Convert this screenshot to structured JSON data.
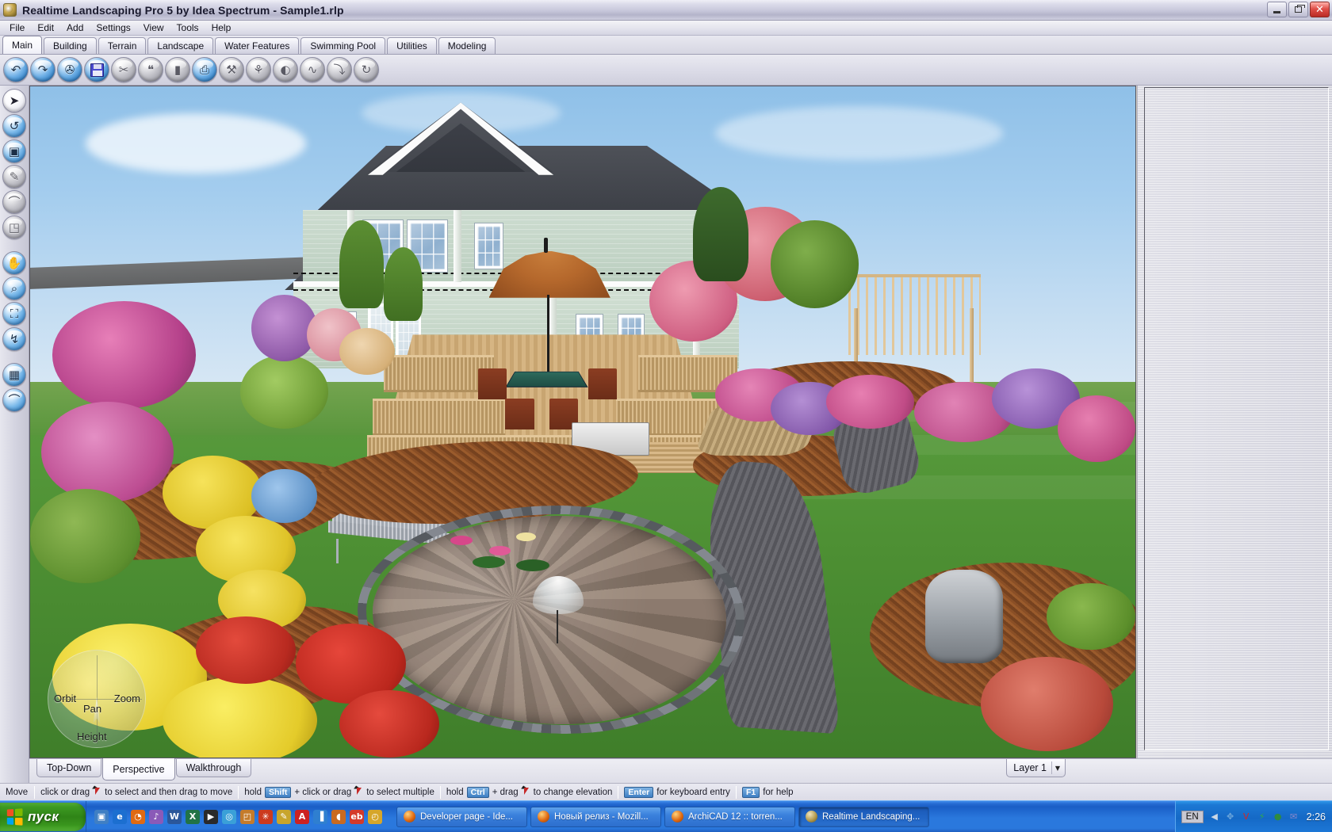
{
  "window": {
    "title": "Realtime Landscaping Pro 5 by Idea Spectrum - Sample1.rlp",
    "app_icon": "app-logo-icon",
    "minimize_label": "Minimize",
    "restore_label": "Restore",
    "close_label": "Close"
  },
  "menu": {
    "items": [
      {
        "label": "File"
      },
      {
        "label": "Edit"
      },
      {
        "label": "Add"
      },
      {
        "label": "Settings"
      },
      {
        "label": "View"
      },
      {
        "label": "Tools"
      },
      {
        "label": "Help"
      }
    ]
  },
  "ribbon_tabs": {
    "active": "Main",
    "items": [
      {
        "label": "Main"
      },
      {
        "label": "Building"
      },
      {
        "label": "Terrain"
      },
      {
        "label": "Landscape"
      },
      {
        "label": "Water Features"
      },
      {
        "label": "Swimming Pool"
      },
      {
        "label": "Utilities"
      },
      {
        "label": "Modeling"
      }
    ]
  },
  "toolbar_top": {
    "buttons": [
      {
        "name": "undo-icon",
        "glyph": "↶",
        "state": "enabled"
      },
      {
        "name": "redo-icon",
        "glyph": "↷",
        "state": "enabled"
      },
      {
        "name": "open-folder-icon",
        "glyph": "✇",
        "state": "enabled"
      },
      {
        "name": "save-disk-icon",
        "glyph": "",
        "state": "enabled"
      },
      {
        "name": "cut-icon",
        "glyph": "✂",
        "state": "disabled"
      },
      {
        "name": "copy-icon",
        "glyph": "❝",
        "state": "disabled"
      },
      {
        "name": "paste-icon",
        "glyph": "▮",
        "state": "disabled"
      },
      {
        "name": "print-icon",
        "glyph": "⎙",
        "state": "enabled"
      },
      {
        "name": "terrain-icon",
        "glyph": "⚒",
        "state": "disabled"
      },
      {
        "name": "flatten-icon",
        "glyph": "⚘",
        "state": "disabled"
      },
      {
        "name": "mirror-icon",
        "glyph": "◐",
        "state": "disabled"
      },
      {
        "name": "smooth-icon",
        "glyph": "∿",
        "state": "disabled"
      },
      {
        "name": "curve-icon",
        "glyph": "⤵",
        "state": "disabled"
      },
      {
        "name": "rotate-icon",
        "glyph": "↻",
        "state": "disabled"
      }
    ]
  },
  "toolbar_left": {
    "buttons": [
      {
        "name": "select-arrow-icon",
        "glyph": "➤",
        "state": "selected"
      },
      {
        "name": "orbit-icon",
        "glyph": "↺",
        "state": "enabled"
      },
      {
        "name": "zoom-region-icon",
        "glyph": "▣",
        "state": "enabled"
      },
      {
        "name": "draw-region-icon",
        "glyph": "✎",
        "state": "disabled"
      },
      {
        "name": "draw-curve-icon",
        "glyph": "⌒",
        "state": "disabled"
      },
      {
        "name": "draw-polyline-icon",
        "glyph": "◳",
        "state": "disabled"
      },
      {
        "name": "pan-hand-icon",
        "glyph": "✋",
        "state": "enabled"
      },
      {
        "name": "zoom-magnifier-icon",
        "glyph": "⌕",
        "state": "enabled"
      },
      {
        "name": "zoom-extents-icon",
        "glyph": "⛶",
        "state": "enabled"
      },
      {
        "name": "walkthrough-icon",
        "glyph": "↯",
        "state": "enabled"
      },
      {
        "name": "terrain-grid-icon",
        "glyph": "▦",
        "state": "enabled"
      },
      {
        "name": "magnet-snap-icon",
        "glyph": "⌒",
        "state": "enabled"
      }
    ]
  },
  "viewport": {
    "navigator": {
      "orbit_label": "Orbit",
      "zoom_label": "Zoom",
      "pan_label": "Pan",
      "height_label": "Height"
    }
  },
  "view_tabs": {
    "active": "Perspective",
    "items": [
      {
        "label": "Top-Down"
      },
      {
        "label": "Perspective"
      },
      {
        "label": "Walkthrough"
      }
    ]
  },
  "layer_select": {
    "value": "Layer 1",
    "arrow": "▼"
  },
  "statusbar": {
    "mode": "Move",
    "hints": [
      {
        "pre": "click or drag",
        "cursor": true,
        "key": "",
        "mid": "",
        "post": "to select and then drag to move"
      },
      {
        "pre": "hold",
        "cursor": false,
        "key": "Shift",
        "mid": "+ click or drag",
        "post": "to select multiple",
        "cursor_after": true
      },
      {
        "pre": "hold",
        "cursor": false,
        "key": "Ctrl",
        "mid": "+ drag",
        "post": "to change elevation",
        "cursor_after": true
      },
      {
        "pre": "",
        "cursor": false,
        "key": "Enter",
        "mid": "",
        "post": "for keyboard entry"
      },
      {
        "pre": "",
        "cursor": false,
        "key": "F1",
        "mid": "",
        "post": "for help"
      }
    ]
  },
  "taskbar": {
    "start_label": "пуск",
    "quick_launch": [
      {
        "name": "show-desktop-icon",
        "glyph": "▣",
        "color": "#3f7fc4"
      },
      {
        "name": "internet-explorer-icon",
        "glyph": "e",
        "color": "#1c6fd0"
      },
      {
        "name": "firefox-icon",
        "glyph": "◔",
        "color": "#e06a12"
      },
      {
        "name": "media-player-icon",
        "glyph": "♪",
        "color": "#8a5ab8"
      },
      {
        "name": "word-icon",
        "glyph": "W",
        "color": "#2b579a"
      },
      {
        "name": "excel-icon",
        "glyph": "X",
        "color": "#217346"
      },
      {
        "name": "video-player-icon",
        "glyph": "▶",
        "color": "#2a2a2a"
      },
      {
        "name": "dvd-tool-icon",
        "glyph": "◎",
        "color": "#3aa0d8"
      },
      {
        "name": "photo-viewer-icon",
        "glyph": "◰",
        "color": "#c47b2a"
      },
      {
        "name": "winamp-icon",
        "glyph": "✳",
        "color": "#cc3a1e"
      },
      {
        "name": "notes-icon",
        "glyph": "✎",
        "color": "#c8a52c"
      },
      {
        "name": "acrobat-icon",
        "glyph": "A",
        "color": "#cc2222"
      },
      {
        "name": "battery-tool-icon",
        "glyph": "▐",
        "color": "#2f7fd0"
      },
      {
        "name": "paint-icon",
        "glyph": "◖",
        "color": "#c96a20"
      },
      {
        "name": "ebay-icon",
        "glyph": "eb",
        "color": "#d43a2a"
      },
      {
        "name": "clock-tool-icon",
        "glyph": "◴",
        "color": "#d6a62a"
      }
    ],
    "tasks": [
      {
        "label": "Developer page - Ide...",
        "icon": "firefox-icon",
        "active": false
      },
      {
        "label": "Новый релиз - Mozill...",
        "icon": "firefox-icon",
        "active": false
      },
      {
        "label": "ArchiCAD 12 :: torren...",
        "icon": "firefox-icon",
        "active": false
      },
      {
        "label": "Realtime Landscaping...",
        "icon": "app-logo-icon",
        "active": true
      }
    ],
    "tray": {
      "language": "EN",
      "icons": [
        {
          "name": "hide-tray-icon",
          "glyph": "◀",
          "color": "#c9d7e6"
        },
        {
          "name": "network-icon",
          "glyph": "✥",
          "color": "#6fa8dc"
        },
        {
          "name": "antivirus-icon",
          "glyph": "V",
          "color": "#cc2b2b"
        },
        {
          "name": "update-icon",
          "glyph": "⚡",
          "color": "#2fa84f"
        },
        {
          "name": "shield-icon",
          "glyph": "●",
          "color": "#2f8b3f"
        },
        {
          "name": "mail-icon",
          "glyph": "✉",
          "color": "#8888cc"
        }
      ],
      "clock": "2:26"
    }
  }
}
